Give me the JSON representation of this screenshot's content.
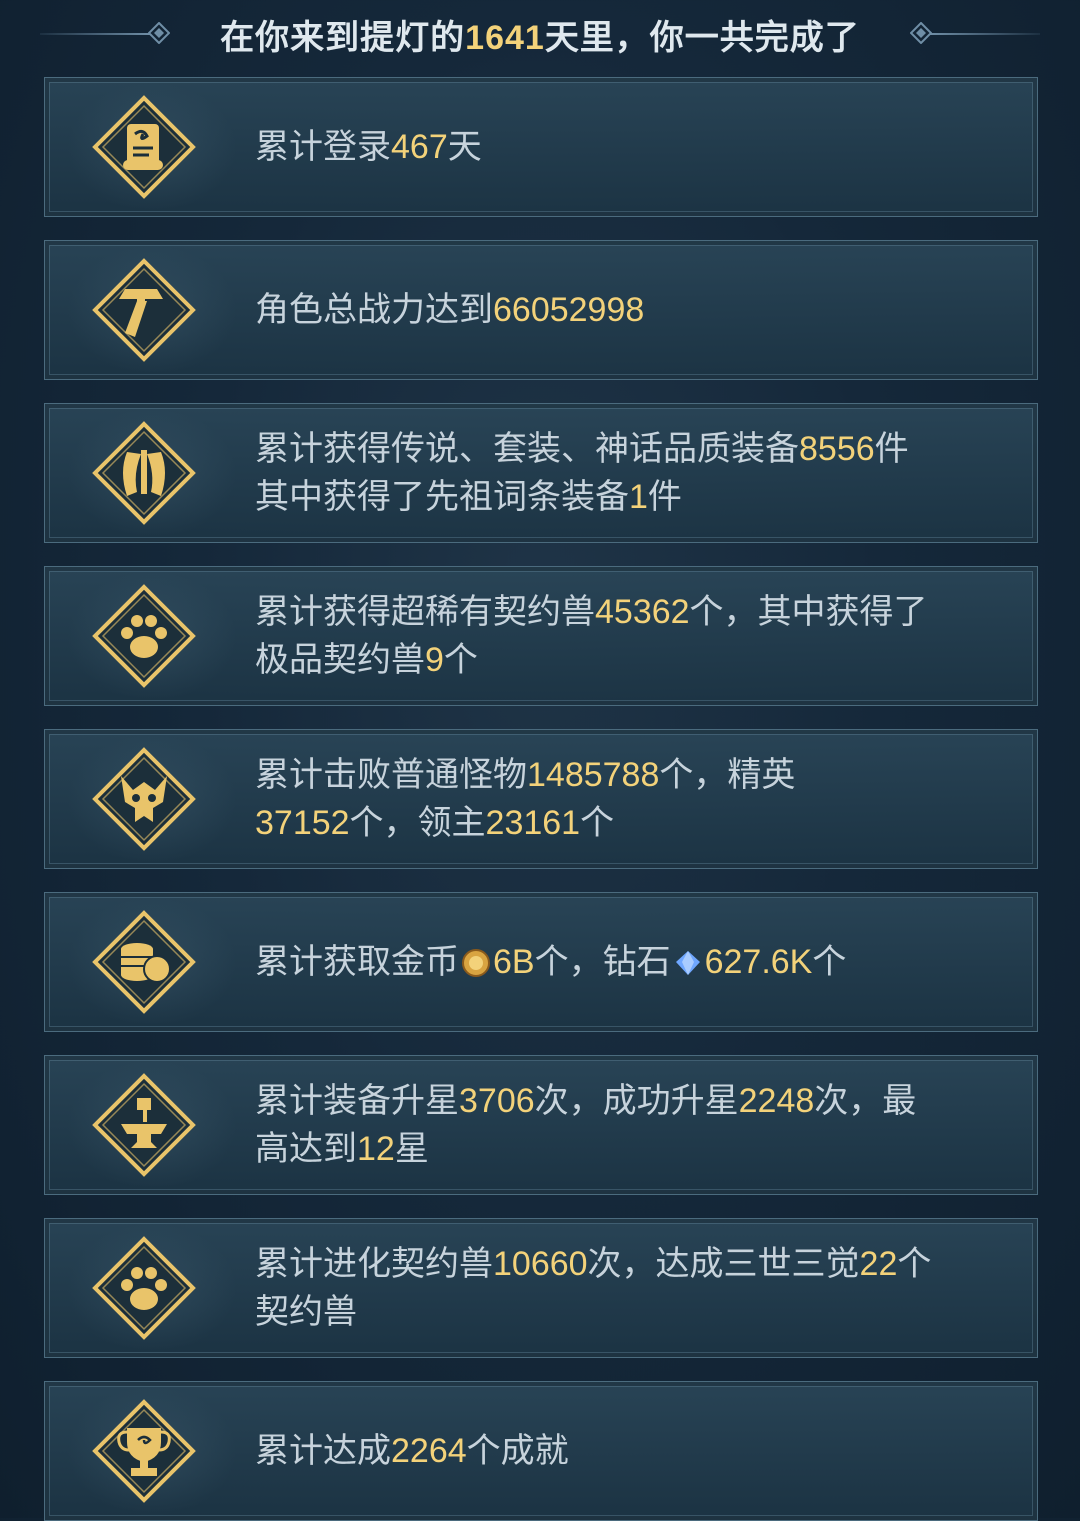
{
  "header": {
    "prefix": "在你来到提灯的",
    "days": "1641",
    "suffix": "天里，你一共完成了"
  },
  "items": [
    {
      "icon": "scroll-icon",
      "lines": [
        [
          {
            "t": "累计登录"
          },
          {
            "n": "467"
          },
          {
            "t": "天"
          }
        ]
      ]
    },
    {
      "icon": "hammer-icon",
      "lines": [
        [
          {
            "t": "角色总战力达到"
          },
          {
            "n": "66052998"
          }
        ]
      ]
    },
    {
      "icon": "armor-icon",
      "lines": [
        [
          {
            "t": "累计获得传说、套装、神话品质装备"
          },
          {
            "n": "8556"
          },
          {
            "t": "件"
          }
        ],
        [
          {
            "t": "其中获得了先祖词条装备"
          },
          {
            "n": "1"
          },
          {
            "t": "件"
          }
        ]
      ]
    },
    {
      "icon": "paw-icon",
      "lines": [
        [
          {
            "t": "累计获得超稀有契约兽"
          },
          {
            "n": "45362"
          },
          {
            "t": "个，其中获得了"
          }
        ],
        [
          {
            "t": "极品契约兽"
          },
          {
            "n": "9"
          },
          {
            "t": "个"
          }
        ]
      ]
    },
    {
      "icon": "monster-skull-icon",
      "lines": [
        [
          {
            "t": "累计击败普通怪物"
          },
          {
            "n": "1485788"
          },
          {
            "t": "个，精英"
          }
        ],
        [
          {
            "n": "37152"
          },
          {
            "t": "个，领主"
          },
          {
            "n": "23161"
          },
          {
            "t": "个"
          }
        ]
      ]
    },
    {
      "icon": "coins-icon",
      "lines": [
        [
          {
            "t": "累计获取金币"
          },
          {
            "i": "gold-coin-icon"
          },
          {
            "n": "6B"
          },
          {
            "t": "个，钻石"
          },
          {
            "i": "diamond-icon"
          },
          {
            "n": "627.6K"
          },
          {
            "t": "个"
          }
        ]
      ]
    },
    {
      "icon": "anvil-icon",
      "lines": [
        [
          {
            "t": "累计装备升星"
          },
          {
            "n": "3706"
          },
          {
            "t": "次，成功升星"
          },
          {
            "n": "2248"
          },
          {
            "t": "次，最"
          }
        ],
        [
          {
            "t": "高达到"
          },
          {
            "n": "12"
          },
          {
            "t": "星"
          }
        ]
      ]
    },
    {
      "icon": "paw-icon",
      "lines": [
        [
          {
            "t": "累计进化契约兽"
          },
          {
            "n": "10660"
          },
          {
            "t": "次，达成三世三觉"
          },
          {
            "n": "22"
          },
          {
            "t": "个"
          }
        ],
        [
          {
            "t": "契约兽"
          }
        ]
      ]
    },
    {
      "icon": "trophy-icon",
      "lines": [
        [
          {
            "t": "累计达成"
          },
          {
            "n": "2264"
          },
          {
            "t": "个成就"
          }
        ]
      ]
    }
  ],
  "colors": {
    "highlight": "#f3d27a",
    "text": "#c7d3dc",
    "gold": "#e9c46a"
  }
}
